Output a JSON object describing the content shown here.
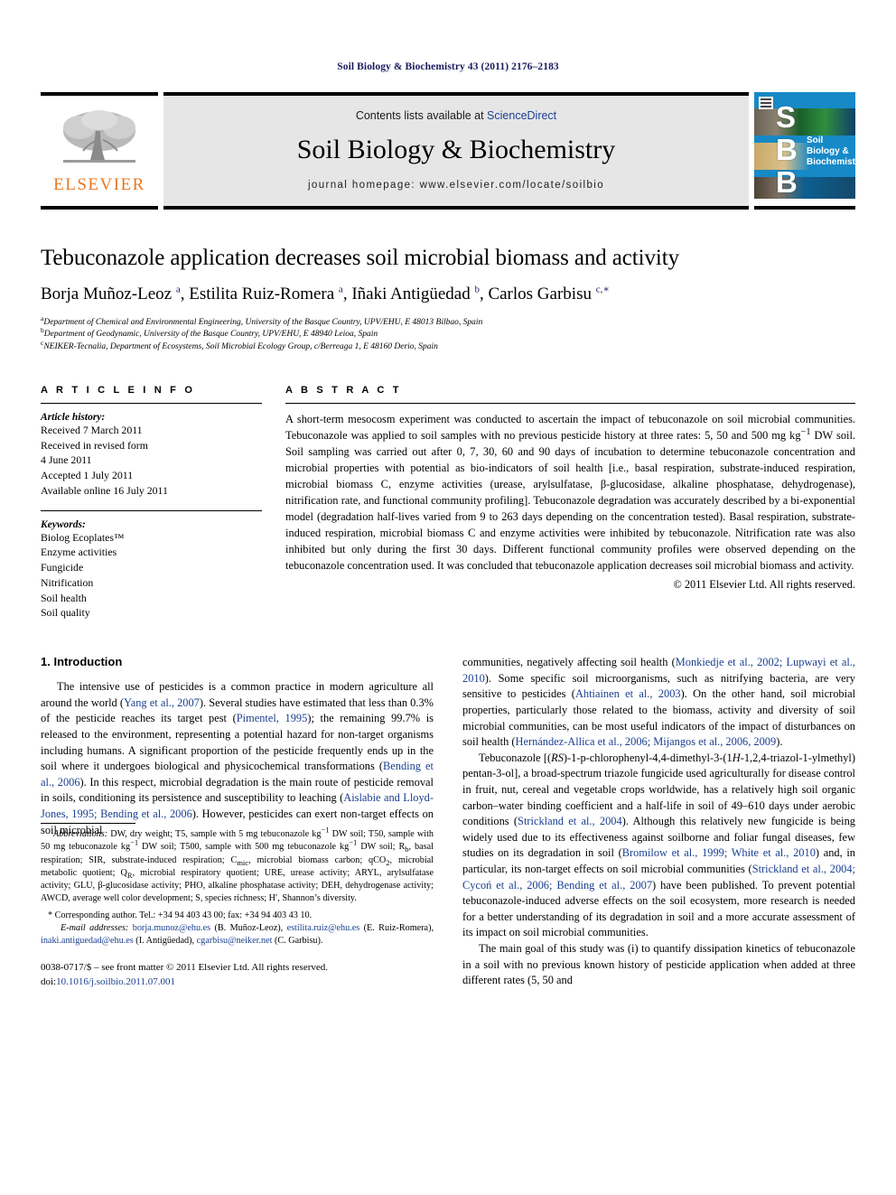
{
  "running_head": "Soil Biology & Biochemistry 43 (2011) 2176–2183",
  "masthead": {
    "publisher_name": "ELSEVIER",
    "contents_prefix": "Contents lists available at ",
    "contents_link": "ScienceDirect",
    "journal_title": "Soil Biology & Biochemistry",
    "homepage": "journal homepage: www.elsevier.com/locate/soilbio",
    "cover": {
      "letters": "S\nB\nB",
      "name": "Soil Biology & Biochemistry"
    }
  },
  "article": {
    "title": "Tebuconazole application decreases soil microbial biomass and activity",
    "authors_html": "Borja Muñoz-Leoz <sup>a</sup>, Estilita Ruiz-Romera <sup>a</sup>, Iñaki Antigüedad <sup>b</sup>, Carlos Garbisu <sup>c,∗</sup>",
    "affiliations": [
      "a Department of Chemical and Environmental Engineering, University of the Basque Country, UPV/EHU, E 48013 Bilbao, Spain",
      "b Department of Geodynamic, University of the Basque Country, UPV/EHU, E 48940 Leioa, Spain",
      "c NEIKER-Tecnalia, Department of Ecosystems, Soil Microbial Ecology Group, c/Berreaga 1, E 48160 Derio, Spain"
    ]
  },
  "article_info": {
    "heading": "A R T I C L E  I N F O",
    "history_label": "Article history:",
    "history": [
      "Received 7 March 2011",
      "Received in revised form",
      "4 June 2011",
      "Accepted 1 July 2011",
      "Available online 16 July 2011"
    ],
    "keywords_label": "Keywords:",
    "keywords": [
      "Biolog Ecoplates™",
      "Enzyme activities",
      "Fungicide",
      "Nitrification",
      "Soil health",
      "Soil quality"
    ]
  },
  "abstract": {
    "heading": "A B S T R A C T",
    "text_html": "A short-term mesocosm experiment was conducted to ascertain the impact of tebuconazole on soil microbial communities. Tebuconazole was applied to soil samples with no previous pesticide history at three rates: 5, 50 and 500 mg kg<sup>−1</sup> DW soil. Soil sampling was carried out after 0, 7, 30, 60 and 90 days of incubation to determine tebuconazole concentration and microbial properties with potential as bio-indicators of soil health [i.e., basal respiration, substrate-induced respiration, microbial biomass C, enzyme activities (urease, arylsulfatase, β-glucosidase, alkaline phosphatase, dehydrogenase), nitrification rate, and functional community profiling]. Tebuconazole degradation was accurately described by a bi-exponential model (degradation half-lives varied from 9 to 263 days depending on the concentration tested). Basal respiration, substrate-induced respiration, microbial biomass C and enzyme activities were inhibited by tebuconazole. Nitrification rate was also inhibited but only during the first 30 days. Different functional community profiles were observed depending on the tebuconazole concentration used. It was concluded that tebuconazole application decreases soil microbial biomass and activity.",
    "copyright": "© 2011 Elsevier Ltd. All rights reserved."
  },
  "introduction": {
    "section_number_title": "1. Introduction",
    "left_paragraphs_html": [
      "The intensive use of pesticides is a common practice in modern agriculture all around the world (<span class=\"ref\">Yang et al., 2007</span>). Several studies have estimated that less than 0.3% of the pesticide reaches its target pest (<span class=\"ref\">Pimentel, 1995</span>); the remaining 99.7% is released to the environment, representing a potential hazard for non-target organisms including humans. A significant proportion of the pesticide frequently ends up in the soil where it undergoes biological and physicochemical transformations (<span class=\"ref\">Bending et al., 2006</span>). In this respect, microbial degradation is the main route of pesticide removal in soils, conditioning its persistence and susceptibility to leaching (<span class=\"ref\">Aislabie and Lloyd-Jones, 1995; Bending et al., 2006</span>). However, pesticides can exert non-target effects on soil microbial"
    ],
    "right_paragraphs_html": [
      "communities, negatively affecting soil health (<span class=\"ref\">Monkiedje et al., 2002; Lupwayi et al., 2010</span>). Some specific soil microorganisms, such as nitrifying bacteria, are very sensitive to pesticides (<span class=\"ref\">Ahtiainen et al., 2003</span>). On the other hand, soil microbial properties, particularly those related to the biomass, activity and diversity of soil microbial communities, can be most useful indicators of the impact of disturbances on soil health (<span class=\"ref\">Hernández-Allica et al., 2006; Mijangos et al., 2006, 2009</span>).",
      "Tebuconazole [(<i>RS</i>)-1-p-chlorophenyl-4,4-dimethyl-3-(1<i>H</i>-1,2,4-triazol-1-ylmethyl) pentan-3-ol], a broad-spectrum triazole fungicide used agriculturally for disease control in fruit, nut, cereal and vegetable crops worldwide, has a relatively high soil organic carbon–water binding coefficient and a half-life in soil of 49–610 days under aerobic conditions (<span class=\"ref\">Strickland et al., 2004</span>). Although this relatively new fungicide is being widely used due to its effectiveness against soilborne and foliar fungal diseases, few studies on its degradation in soil (<span class=\"ref\">Bromilow et al., 1999; White et al., 2010</span>) and, in particular, its non-target effects on soil microbial communities (<span class=\"ref\">Strickland et al., 2004; Cycoń et al., 2006; Bending et al., 2007</span>) have been published. To prevent potential tebuconazole-induced adverse effects on the soil ecosystem, more research is needed for a better understanding of its degradation in soil and a more accurate assessment of its impact on soil microbial communities.",
      "The main goal of this study was (i) to quantify dissipation kinetics of tebuconazole in a soil with no previous known history of pesticide application when added at three different rates (5, 50 and"
    ]
  },
  "footnotes": {
    "abbreviations_html": "<i>Abbreviations:</i> DW, dry weight; T5, sample with 5 mg tebuconazole kg<sup>−1</sup> DW soil; T50, sample with 50 mg tebuconazole kg<sup>−1</sup> DW soil; T500, sample with 500 mg tebuconazole kg<sup>−1</sup> DW soil; R<sub>b</sub>, basal respiration; SIR, substrate-induced respiration; C<sub>mic</sub>, microbial biomass carbon; qCO<sub>2</sub>, microbial metabolic quotient; Q<sub>R</sub>, microbial respiratory quotient; URE, urease activity; ARYL, arylsulfatase activity; GLU, β-glucosidase activity; PHO, alkaline phosphatase activity; DEH, dehydrogenase activity; AWCD, average well color development; S, species richness; H′, Shannon’s diversity.",
    "corresponding_html": "* Corresponding author. Tel.: +34 94 403 43 00; fax: +34 94 403 43 10.",
    "emails_html": "<i>E-mail addresses:</i> <span class=\"ref\">borja.munoz@ehu.es</span> (B. Muñoz-Leoz), <span class=\"ref\">estilita.ruiz@ehu.es</span> (E. Ruiz-Romera), <span class=\"ref\">inaki.antiguedad@ehu.es</span> (I. Antigüedad), <span class=\"ref\">cgarbisu@neiker.net</span> (C. Garbisu)."
  },
  "footer": {
    "issn_line_html": "0038-0717/$ – see front matter © 2011 Elsevier Ltd. All rights reserved.",
    "doi_label": "doi:",
    "doi_value": "10.1016/j.soilbio.2011.07.001"
  }
}
